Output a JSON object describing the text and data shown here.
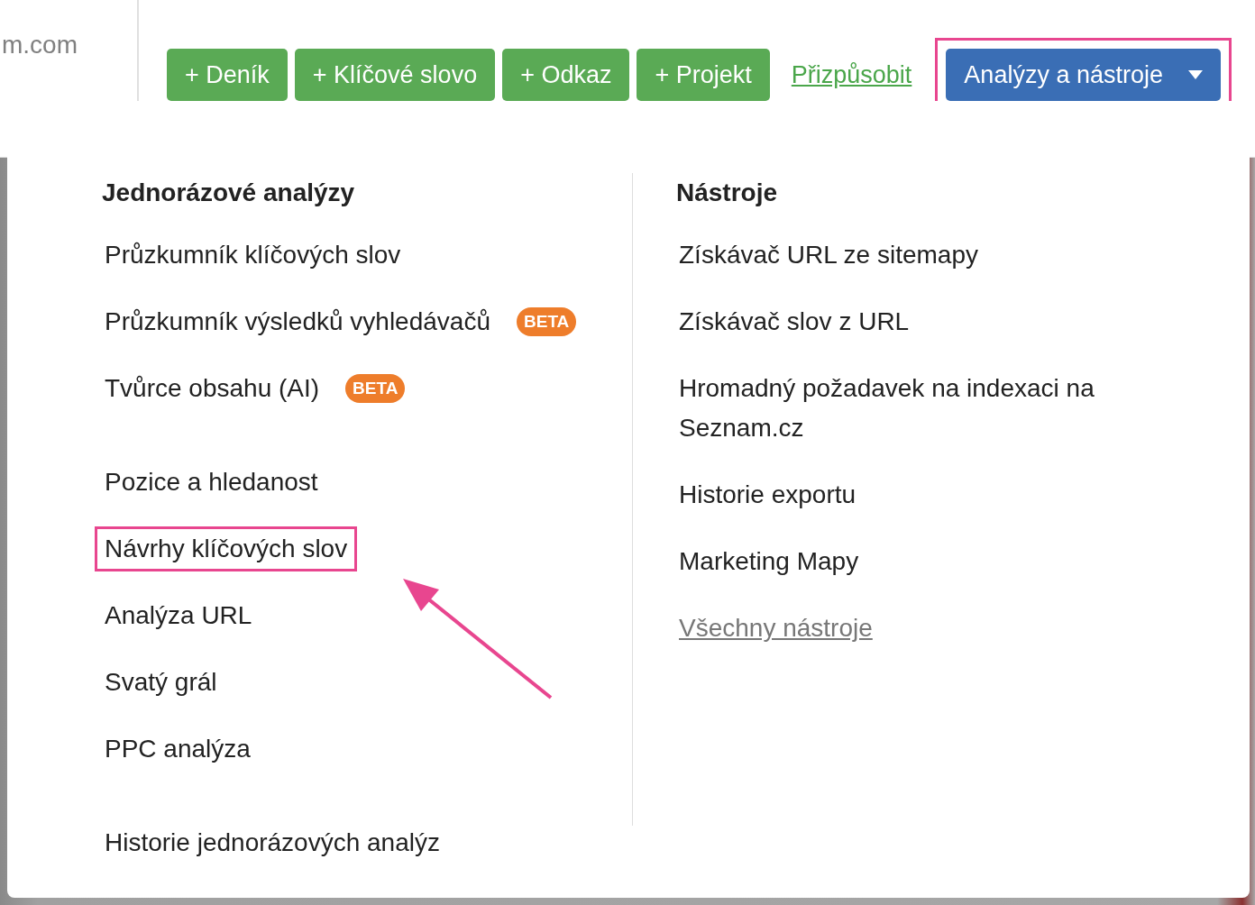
{
  "header": {
    "logo_text": "m.com",
    "buttons": [
      {
        "icon": "+",
        "label": "Deník"
      },
      {
        "icon": "+",
        "label": "Klíčové slovo"
      },
      {
        "icon": "+",
        "label": "Odkaz"
      },
      {
        "icon": "+",
        "label": "Projekt"
      }
    ],
    "customize_link": "Přizpůsobit",
    "menu_button": {
      "label": "Analýzy a nástroje",
      "expanded": true,
      "highlighted": true
    }
  },
  "dropdown": {
    "columns": [
      {
        "heading": "Jednorázové analýzy",
        "groups": [
          [
            {
              "kind": "item",
              "label": "Průzkumník klíčových slov",
              "highlighted": false
            },
            {
              "kind": "item",
              "label": "Průzkumník výsledků vyhledávačů",
              "badge": "BETA",
              "highlighted": false
            },
            {
              "kind": "item",
              "label": "Tvůrce obsahu (AI)",
              "badge": "BETA",
              "highlighted": false
            }
          ],
          [
            {
              "kind": "item",
              "label": "Pozice a hledanost",
              "highlighted": false
            },
            {
              "kind": "item",
              "label": "Návrhy klíčových slov",
              "highlighted": true
            },
            {
              "kind": "item",
              "label": "Analýza URL",
              "highlighted": false
            },
            {
              "kind": "item",
              "label": "Svatý grál",
              "highlighted": false
            },
            {
              "kind": "item",
              "label": "PPC analýza",
              "highlighted": false
            }
          ],
          [
            {
              "kind": "item",
              "label": "Historie jednorázových analýz",
              "highlighted": false
            }
          ]
        ]
      },
      {
        "heading": "Nástroje",
        "groups": [
          [
            {
              "kind": "item",
              "label": "Získávač URL ze sitemapy",
              "highlighted": false
            },
            {
              "kind": "item",
              "label": "Získávač slov z URL",
              "highlighted": false
            },
            {
              "kind": "item",
              "label": "Hromadný požadavek na indexaci na Seznam.cz",
              "highlighted": false
            },
            {
              "kind": "item",
              "label": "Historie exportu",
              "highlighted": false
            },
            {
              "kind": "item",
              "label": "Marketing Mapy",
              "highlighted": false
            },
            {
              "kind": "link",
              "label": "Všechny nástroje",
              "highlighted": false
            }
          ]
        ]
      }
    ]
  }
}
